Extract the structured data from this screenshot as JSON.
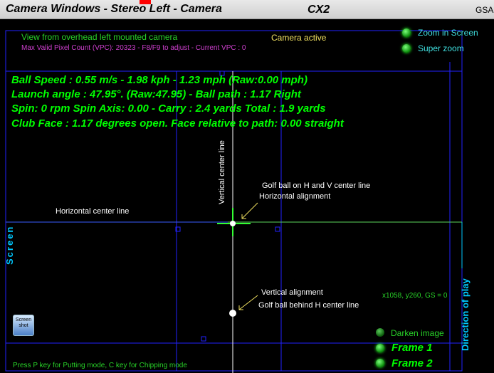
{
  "window": {
    "title": "Camera Windows - Stereo Left - Camera",
    "camera_id": "CX2",
    "right_text": "GSA"
  },
  "header": {
    "view_label": "View from overhead left mounted camera",
    "vpc_info": "Max Valid Pixel Count (VPC): 20323  - F8/F9 to adjust - Current VPC : 0",
    "camera_status": "Camera active"
  },
  "options": {
    "zoom_in_screen": "Zoom in Screen",
    "super_zoom": "Super zoom"
  },
  "stats": {
    "line1": "Ball Speed : 0.55 m/s - 1.98 kph - 1.23 mph (Raw:0.00 mph)",
    "line2": "Launch angle : 47.95°. (Raw:47.95) - Ball path : 1.17 Right",
    "line3": "Spin: 0 rpm  Spin Axis: 0.00 - Carry : 2.4 yards  Total : 1.9 yards",
    "line4": "Club Face : 1.17 degrees open.    Face relative to path: 0.00 straight"
  },
  "annotations": {
    "vertical_center_line": "Vertical center line",
    "horizontal_center_line": "Horizontal center line",
    "golf_ball_hv": "Golf ball on H and V center line",
    "horizontal_alignment": "Horizontal alignment",
    "vertical_alignment": "Vertical alignment",
    "golf_ball_behind": "Golf ball behind H center line",
    "screen_label": "Screen",
    "direction_of_play": "Direction of play"
  },
  "readout": {
    "coords": "x1058, y260, GS = 0"
  },
  "controls": {
    "screenshot_label_1": "Screen",
    "screenshot_label_2": "shot",
    "darken_image": "Darken image",
    "frame1": "Frame 1",
    "frame2": "Frame 2"
  },
  "footer": {
    "hint": "Press P key for Putting mode, C key for Chipping mode"
  },
  "colors": {
    "stat_green": "#00ff00",
    "grid_blue": "#2222ff",
    "label_magenta": "#d040d0",
    "active_yellow": "#f0e060",
    "cyan_label": "#40e0e0"
  }
}
